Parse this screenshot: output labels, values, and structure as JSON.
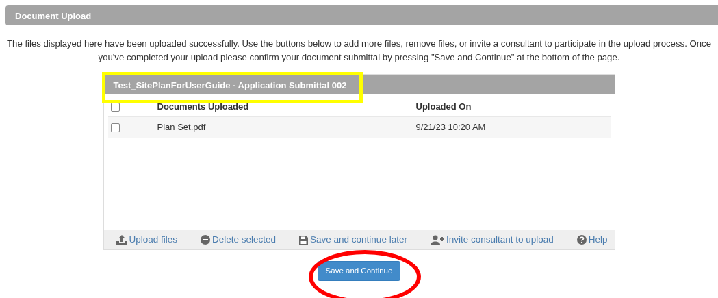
{
  "header": {
    "title": "Document Upload"
  },
  "intro": "The files displayed here have been uploaded successfully. Use the buttons below to add more files, remove files, or invite a consultant to participate in the upload process. Once you've completed your upload please confirm your document submittal by pressing \"Save and Continue\" at the bottom of the page.",
  "panel": {
    "title": "Test_SitePlanForUserGuide - Application Submittal 002",
    "table": {
      "select_all": {
        "checked": false
      },
      "columns": [
        "Documents Uploaded",
        "Uploaded On"
      ],
      "rows": [
        {
          "checked": false,
          "cells": [
            "Plan Set.pdf",
            "9/21/23 10:20 AM"
          ]
        }
      ]
    },
    "actions": [
      {
        "kind": "upload",
        "label": "Upload files"
      },
      {
        "kind": "delete",
        "label": "Delete selected"
      },
      {
        "kind": "save",
        "label": "Save and continue later"
      },
      {
        "kind": "invite",
        "label": "Invite consultant to upload"
      },
      {
        "kind": "help",
        "label": "Help"
      }
    ]
  },
  "primary_button": "Save and Continue",
  "annotations": [
    {
      "kind": "rectangle",
      "color": "#ffff00"
    },
    {
      "kind": "ellipse",
      "color": "#ff0000"
    }
  ]
}
